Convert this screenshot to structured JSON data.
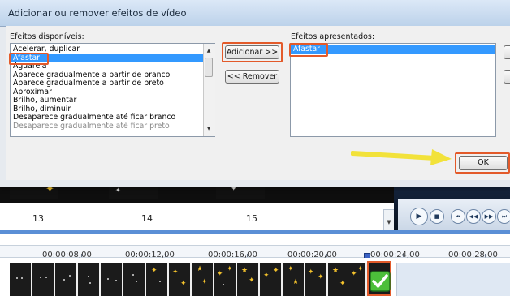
{
  "dialog": {
    "title": "Adicionar ou remover efeitos de vídeo",
    "available_label": "Efeitos disponíveis:",
    "available_items": [
      "Acelerar, duplicar",
      "Afastar",
      "Aguarela",
      "Aparece gradualmente a partir de branco",
      "Aparece gradualmente a partir de preto",
      "Aproximar",
      "Brilho, aumentar",
      "Brilho, diminuir",
      "Desaparece gradualmente até ficar branco",
      "Desaparece gradualmente até ficar preto"
    ],
    "selected_available": "Afastar",
    "add_button": "Adicionar >>",
    "remove_button": "<< Remover",
    "displayed_label": "Efeitos apresentados:",
    "displayed_items": [
      "Afastar"
    ],
    "ok_button": "OK"
  },
  "storyboard": {
    "thumb_numbers": [
      "13",
      "14",
      "15"
    ],
    "player_buttons": [
      "play",
      "stop",
      "previous",
      "rewind",
      "forward",
      "next"
    ]
  },
  "timeline": {
    "ticks": [
      "00:00:08,00",
      "00:00:12,00",
      "00:00:16,00",
      "00:00:20,00",
      "00:00:24,00",
      "00:00:28,00"
    ]
  },
  "colors": {
    "highlight": "#e35a2a",
    "selection": "#3399ff",
    "arrow": "#f2e23a",
    "check": "#34a828",
    "timeline_accent": "#5b8fd6"
  }
}
